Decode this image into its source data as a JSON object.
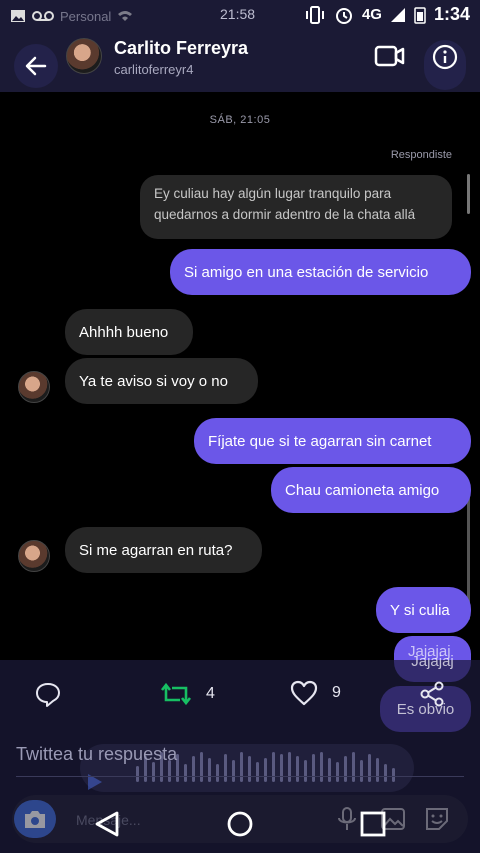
{
  "status_bar": {
    "carrier": "Personal",
    "center_time": "21:58",
    "network": "4G",
    "time": "1:34"
  },
  "header": {
    "name": "Carlito Ferreyra",
    "username": "carlitoferreyr4"
  },
  "chat": {
    "date_separator": "SÁB, 21:05",
    "replied_label": "Respondiste",
    "quoted_message": "Ey culiau hay algún lugar tranquilo para quedarnos a dormir adentro de la chata allá",
    "messages": [
      {
        "side": "out",
        "text": "Si amigo en una estación de servicio"
      },
      {
        "side": "in",
        "text": "Ahhhh bueno"
      },
      {
        "side": "in",
        "text": "Ya te aviso si voy o no"
      },
      {
        "side": "out",
        "text": "Fíjate que si te agarran sin carnet"
      },
      {
        "side": "out",
        "text": "Chau camioneta amigo"
      },
      {
        "side": "in",
        "text": "Si me agarran en ruta?"
      },
      {
        "side": "out",
        "text": "Y si culia"
      },
      {
        "side": "out",
        "text": "Jajajaj"
      },
      {
        "side": "out",
        "text": "Es obvio"
      }
    ]
  },
  "actions": {
    "retweets": "4",
    "likes": "9"
  },
  "reply": {
    "placeholder": "Twittea tu respuesta"
  },
  "composer": {
    "placeholder": "Mensaje..."
  },
  "colors": {
    "accent": "#6b57e8",
    "incoming": "#262626",
    "retweet_green": "#17bf63",
    "header_bg": "#1b1a35"
  }
}
